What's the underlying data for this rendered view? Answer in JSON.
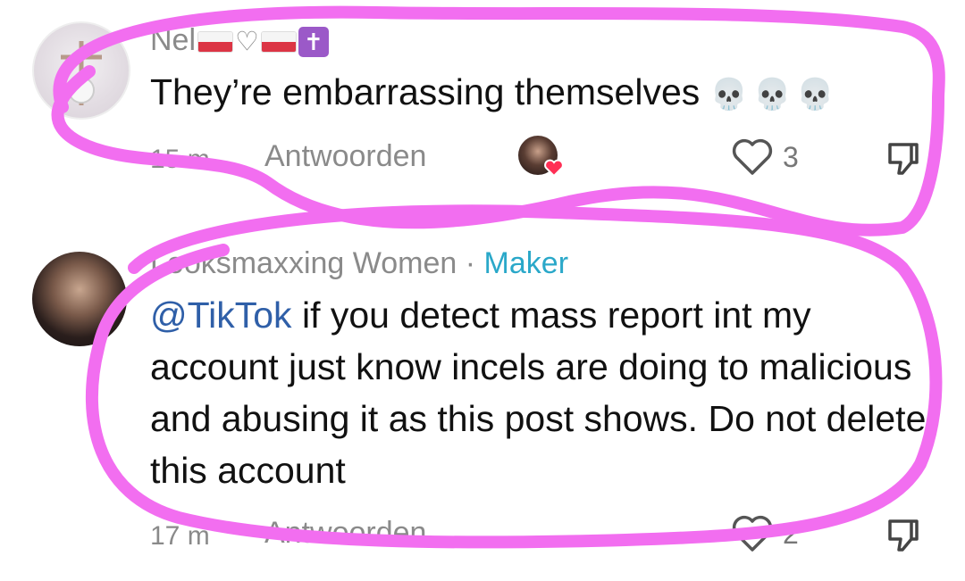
{
  "comments": [
    {
      "username": "Nel",
      "text": "They’re embarrassing themselves",
      "emoji": "💀💀💀",
      "time": "15 m",
      "reply_label": "Antwoorden",
      "likes": "3",
      "creator_liked": true
    },
    {
      "username": "Looksmaxxing Women",
      "separator": "·",
      "badge": "Maker",
      "mention": "@TikTok",
      "text": " if you detect mass report int my account just know incels are doing to malicious and abusing it as this post shows. Do not delete this account",
      "time": "17 m",
      "reply_label": "Antwoorden",
      "likes": "2"
    }
  ],
  "annotation_color": "#f26ef0"
}
